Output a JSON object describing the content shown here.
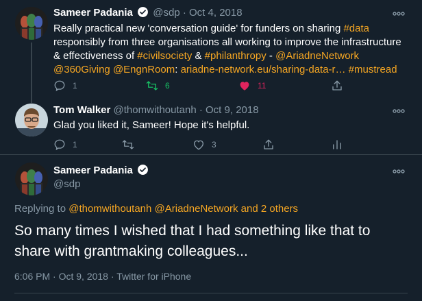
{
  "tweet1": {
    "name": "Sameer Padania",
    "handle": "@sdp",
    "dot": "·",
    "date": "Oct 4, 2018",
    "segments": [
      {
        "t": "Really practical new 'conversation guide' for funders on sharing ",
        "link": false
      },
      {
        "t": "#data",
        "link": true
      },
      {
        "t": " responsibly from three organisations all working to improve the infrastructure & effectiveness of ",
        "link": false
      },
      {
        "t": "#civilsociety",
        "link": true
      },
      {
        "t": " & ",
        "link": false
      },
      {
        "t": "#philanthropy",
        "link": true
      },
      {
        "t": " - ",
        "link": false
      },
      {
        "t": "@AriadneNetwork",
        "link": true
      },
      {
        "t": " ",
        "link": false
      },
      {
        "t": "@360Giving",
        "link": true
      },
      {
        "t": " ",
        "link": false
      },
      {
        "t": "@EngnRoom",
        "link": true
      },
      {
        "t": ": ",
        "link": false
      },
      {
        "t": "ariadne-network.eu/sharing-data-r…",
        "link": true
      },
      {
        "t": " ",
        "link": false
      },
      {
        "t": "#mustread",
        "link": true
      }
    ],
    "reply_count": "1",
    "retweet_count": "6",
    "like_count": "11"
  },
  "tweet2": {
    "name": "Tom Walker",
    "handle": "@thomwithoutanh",
    "dot": "·",
    "date": "Oct 9, 2018",
    "text": "Glad you liked it, Sameer! Hope it's helpful.",
    "reply_count": "1",
    "like_count": "3"
  },
  "tweet3": {
    "name": "Sameer Padania",
    "handle": "@sdp",
    "replying_prefix": "Replying to ",
    "replying_user1": "@thomwithoutanh",
    "replying_user2": "@AriadneNetwork",
    "replying_and": " and ",
    "replying_others": "2 others",
    "text_line1": "So many times I wished that I had something like that to",
    "text_line2": "share with grantmaking colleagues...",
    "time": "6:06 PM",
    "date": "Oct 9, 2018",
    "source": "Twitter for iPhone",
    "sep": "·"
  },
  "colors": {
    "background": "#15202b",
    "link": "#f5a623",
    "muted": "#8899a6",
    "retweet_active": "#17bf63",
    "like_active": "#e0245e",
    "divider": "#38444d"
  }
}
